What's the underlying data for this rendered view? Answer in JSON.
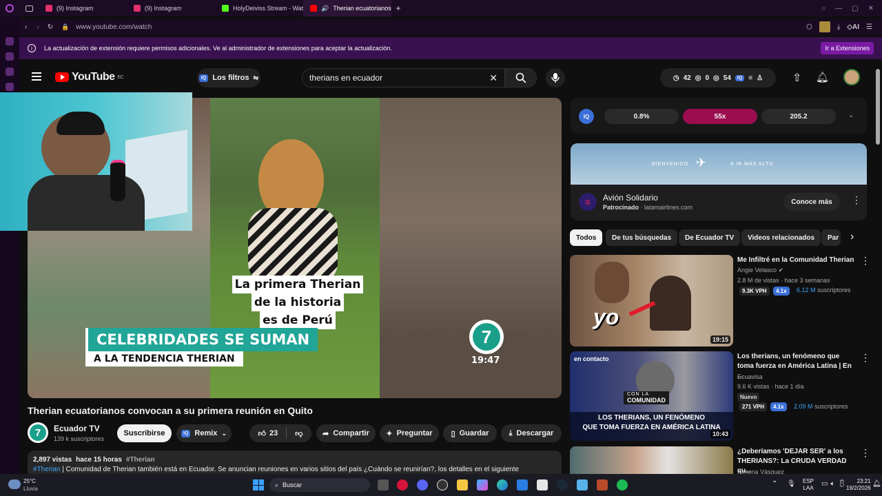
{
  "browser": {
    "tabs": [
      {
        "label": "(9) Instagram",
        "color": "#e1306c"
      },
      {
        "label": "(9) Instagram",
        "color": "#e1306c"
      },
      {
        "label": "HolyDeiviss Stream - Wat",
        "color": "#53fc18"
      },
      {
        "label": "Therian ecuatorianos",
        "color": "#ff0000"
      }
    ],
    "url": "www.youtube.com/watch",
    "banner_text": "La actualización de extensión requiere permisos adicionales. Ve al administrador de extensiones para aceptar la actualización.",
    "banner_button": "Ir a Extensiones",
    "ai_label": "AI"
  },
  "yt": {
    "logo": "YouTube",
    "region": "EC",
    "filters_label": "Los filtros",
    "search_value": "therians en ecuador",
    "stats": {
      "a": "42",
      "b": "0",
      "c": "54"
    }
  },
  "video": {
    "overlay_line1": "La primera Therian",
    "overlay_line2": "de la historia",
    "overlay_line3": "es de Perú",
    "banner_main": "CELEBRIDADES SE SUMAN",
    "banner_sub": "A LA TENDENCIA THERIAN",
    "logo_time": "19:47",
    "title": "Therian ecuatorianos convocan a su primera reunión en Quito"
  },
  "channel": {
    "name": "Ecuador TV",
    "subs": "139 k suscriptores",
    "subscribe": "Suscribirse",
    "remix": "Remix"
  },
  "actions": {
    "likes": "23",
    "share": "Compartir",
    "ask": "Preguntar",
    "save": "Guardar",
    "download": "Descargar"
  },
  "description": {
    "views": "2,897 vistas",
    "time": "hace 15 horas",
    "tag": "#Therian",
    "line2_tag": "#Therian",
    "line2_text": "| Comunidad de Therian también está en Ecuador. Se anuncian reuniones en varios sitios del país ¿Cuándo se reunirían?, los detalles en el siguiente"
  },
  "iq": {
    "stat1": "0.8%",
    "stat2": "55x",
    "stat3": "205.2",
    "label": "IQ"
  },
  "ad": {
    "banner_left": "BIENVENIDO",
    "banner_right": "A IR MÁS ALTO",
    "title": "Avión Solidario",
    "sponsored": "Patrocinado",
    "domain": "latamairlines.com",
    "cta": "Conoce más"
  },
  "chips": [
    "Todos",
    "De tus búsquedas",
    "De Ecuador TV",
    "Videos relacionados",
    "Par"
  ],
  "recommendations": [
    {
      "title": "Me Infiltré en la Comunidad Therian",
      "channel": "Angie Velasco",
      "meta": "2.8 M de vistas · hace 3 semanas",
      "vph": "9.3K VPH",
      "ratio": "4.1x",
      "subs_num": "6.12 M",
      "subs_label": "suscriptores",
      "duration": "19:15",
      "thumb_text": "yo"
    },
    {
      "title": "Los therians, un fenómeno que toma fuerza en América Latina | En ...",
      "channel": "Ecuavisa",
      "meta": "9.6 K vistas · hace 1 día",
      "new": "Nuevo",
      "vph": "271 VPH",
      "ratio": "4.1x",
      "subs_num": "2.09 M",
      "subs_label": "suscriptores",
      "duration": "10:43",
      "thumb_line1": "LOS THERIANS, UN FENÓMENO",
      "thumb_line2": "QUE TOMA FUERZA EN AMÉRICA LATINA",
      "thumb_brand": "en contacto",
      "thumb_tag": "COMUNIDAD",
      "thumb_tag_top": "CON LA"
    },
    {
      "title": "¿Deberíamos 'DEJAR SER' a los THERIANS?: La CRUDA VERDAD qu...",
      "channel": "Ximena Vásquez"
    }
  ],
  "taskbar": {
    "temp": "25°C",
    "weather": "Lluvia",
    "search": "Buscar",
    "lang1": "ESP",
    "lang2": "LAA",
    "time": "23:21",
    "date": "19/2/2026"
  }
}
